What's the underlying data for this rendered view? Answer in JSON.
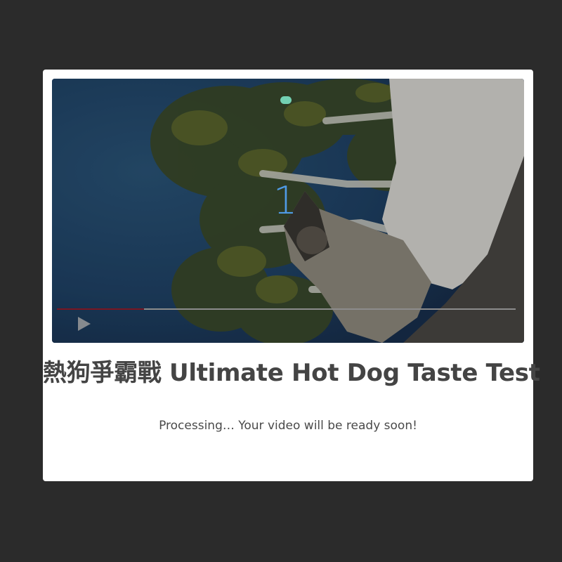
{
  "video": {
    "countdown": "1",
    "progress": 0.19,
    "play_icon": "play-icon",
    "status_dot_color": "#73d1b3",
    "progress_color": "#7a1622"
  },
  "title": "熱狗爭霸戰 Ultimate Hot Dog Taste Test",
  "status_message": "Processing… Your video will be ready soon!"
}
